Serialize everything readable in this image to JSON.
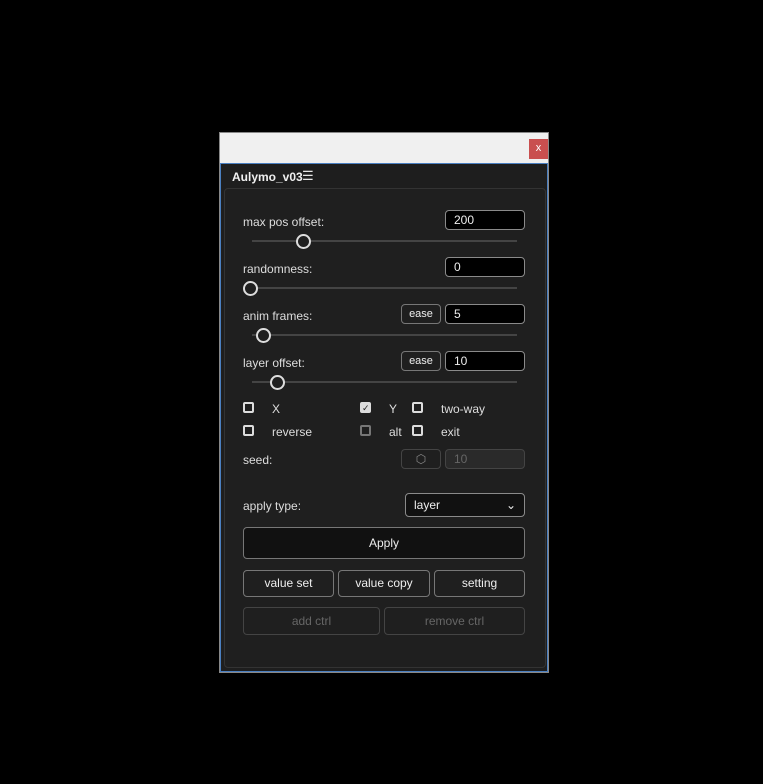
{
  "window": {
    "close_label": "x",
    "title": "Aulymo_v03",
    "menu_icon": "hamburger-icon"
  },
  "sliders": [
    {
      "label": "max pos offset:",
      "value": "200",
      "position": 0.2,
      "ease": null
    },
    {
      "label": "randomness:",
      "value": "0",
      "position": 0,
      "ease": null
    },
    {
      "label": "anim frames:",
      "value": "5",
      "position": 0.05,
      "ease": "ease"
    },
    {
      "label": "layer offset:",
      "value": "10",
      "position": 0.1,
      "ease": "ease"
    }
  ],
  "checkboxes": [
    {
      "label": "X",
      "checked": false
    },
    {
      "label": "Y",
      "checked": true
    },
    {
      "label": "two-way",
      "checked": false
    },
    {
      "label": "reverse",
      "checked": false
    },
    {
      "label": "alt",
      "checked": false,
      "disabled": true
    },
    {
      "label": "exit",
      "checked": false
    }
  ],
  "seed": {
    "label": "seed:",
    "value": "10",
    "icon": "dice-icon"
  },
  "apply_type": {
    "label": "apply type:",
    "selected": "layer"
  },
  "buttons": {
    "apply": "Apply",
    "value_set": "value set",
    "value_copy": "value copy",
    "setting": "setting",
    "add_ctrl": "add ctrl",
    "remove_ctrl": "remove ctrl"
  }
}
